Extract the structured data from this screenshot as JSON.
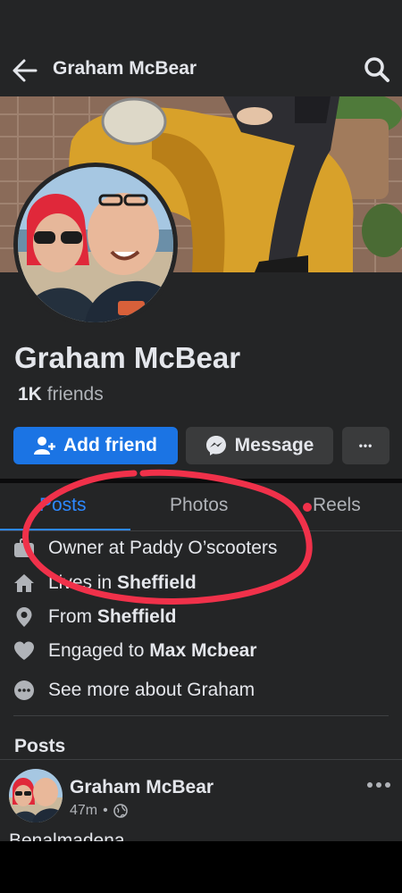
{
  "header": {
    "title": "Graham McBear",
    "back_icon": "arrow-left-icon",
    "search_icon": "search-icon"
  },
  "profile": {
    "name": "Graham McBear",
    "friends_count": "1K",
    "friends_label": "friends"
  },
  "actions": {
    "add_friend": "Add friend",
    "message": "Message",
    "more": "•••"
  },
  "tabs": [
    {
      "label": "Posts",
      "active": true
    },
    {
      "label": "Photos",
      "active": false
    },
    {
      "label": "Reels",
      "active": false
    }
  ],
  "about": [
    {
      "icon": "briefcase-icon",
      "prefix": "Owner at Paddy O’scooters",
      "bold": ""
    },
    {
      "icon": "home-icon",
      "prefix": "Lives in ",
      "bold": "Sheffield"
    },
    {
      "icon": "location-pin-icon",
      "prefix": "From ",
      "bold": "Sheffield"
    },
    {
      "icon": "heart-icon",
      "prefix": "Engaged to ",
      "bold": "Max Mcbear"
    },
    {
      "icon": "more-dots-icon",
      "prefix": "See more about Graham",
      "bold": ""
    }
  ],
  "posts_section": {
    "heading": "Posts"
  },
  "post": {
    "author": "Graham McBear",
    "time": "47m",
    "separator": "•",
    "text": "Benalmadena"
  },
  "colors": {
    "background": "#242526",
    "accent": "#1b74e4",
    "annotation_red": "#f0314a"
  }
}
